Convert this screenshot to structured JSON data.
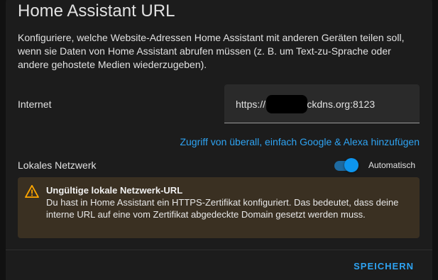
{
  "dialog": {
    "title": "Home Assistant URL",
    "description": "Konfiguriere, welche Website-Adressen Home Assistant mit anderen Geräten teilen soll, wenn sie Daten von Home Assistant abrufen müssen (z. B. um Text-zu-Sprache oder andere gehostete Medien wiederzugeben)."
  },
  "internet": {
    "label": "Internet",
    "url_value": "https://          .duckdns.org:8123",
    "cloud_link": "Zugriff von überall, einfach Google & Alexa hinzufügen"
  },
  "local_network": {
    "label": "Lokales Netzwerk",
    "toggle_label": "Automatisch",
    "toggle_on": true
  },
  "alert": {
    "icon": "warning-icon",
    "title": "Ungültige lokale Netzwerk-URL",
    "message": "Du hast in Home Assistant ein HTTPS-Zertifikat konfiguriert. Das bedeutet, dass deine interne URL auf eine vom Zertifikat abgedeckte Domain gesetzt werden muss."
  },
  "footer": {
    "save_label": "SPEICHERN"
  },
  "colors": {
    "accent": "#2ea3f2",
    "warning": "#ffa600",
    "warning_background": "#3a3022",
    "card_background": "#1c1c1c"
  }
}
